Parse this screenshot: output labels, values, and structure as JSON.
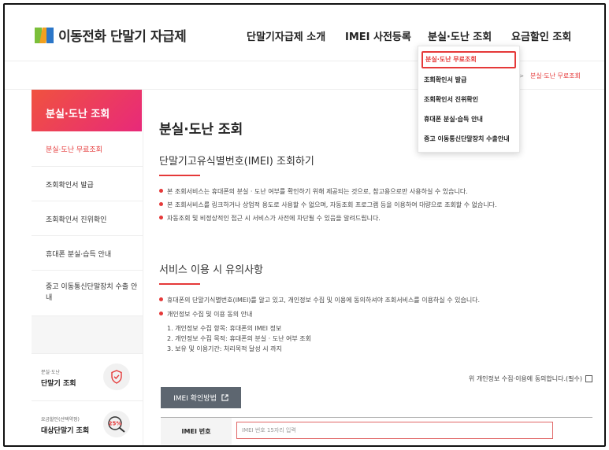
{
  "header": {
    "logo_text": "이동전화 단말기 자급제",
    "nav": [
      "단말기자급제 소개",
      "IMEI 사전등록",
      "분실·도난 조회",
      "요금할인 조회"
    ]
  },
  "dropdown": {
    "items": [
      "분실·도난 무료조회",
      "조회확인서 발급",
      "조회확인서 진위확인",
      "휴대폰 분실·습득 안내",
      "중고 이동통신단말장치 수출안내"
    ]
  },
  "breadcrumb": {
    "separator": ">",
    "current": "분실·도난 무료조회"
  },
  "sidebar": {
    "title": "분실·도난 조회",
    "items": [
      "분실·도난 무료조회",
      "조회확인서 발급",
      "조회확인서 진위확인",
      "휴대폰 분실·습득 안내",
      "중고 이동통신단말장치 수출 안내"
    ],
    "card1": {
      "small": "분실·도난",
      "big": "단말기 조회"
    },
    "card2": {
      "small": "요금할인(선택약정)",
      "big": "대상단말기 조회",
      "badge": "25%"
    }
  },
  "main": {
    "page_title": "분실·도난 조회",
    "section1": {
      "title": "단말기고유식별번호(IMEI) 조회하기",
      "bullets": [
        "본 조회서비스는 휴대폰의 분실 · 도난 여부를 확인하기 위해 제공되는 것으로, 참고용으로만 사용하실 수 있습니다.",
        "본 조회서비스를 링크하거나 상업적 용도로 사용할 수 없으며, 자동조회 프로그램 등을 이용하여 대량으로 조회할 수 없습니다.",
        "자동조회 및 비정상적인 접근 시 서비스가 사전에 차단될 수 있음을 알려드립니다."
      ]
    },
    "section2": {
      "title": "서비스 이용 시 유의사항",
      "bullets": [
        "휴대폰의 단말기식별번호(IMEI)를 알고 있고, 개인정보 수집 및 이용에 동의하셔야 조회서비스를 이용하실 수 있습니다.",
        "개인정보 수집 및 이용 동의 안내"
      ],
      "details": [
        "1. 개인정보 수집 항목: 휴대폰의 IMEI 정보",
        "2. 개인정보 수집 목적: 휴대폰의 분실 · 도난 여부 조회",
        "3. 보유 및 이용기간: 처리목적 달성 시 까지"
      ]
    },
    "agree_label": "위 개인정보 수집·이용에 동의합니다.(필수)",
    "how_button": "IMEI 확인방법",
    "imei_label": "IMEI 번호",
    "imei_placeholder": "IMEI 번호 15자리 입력"
  }
}
